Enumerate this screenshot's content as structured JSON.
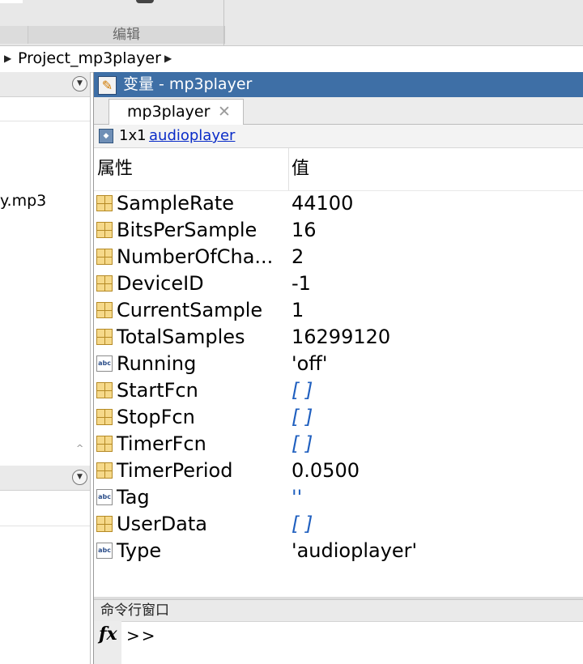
{
  "toolstrip": {
    "section_caption": "编辑"
  },
  "address_bar": {
    "crumb": "Project_mp3player"
  },
  "current_folder": {
    "file_partial": "y.mp3"
  },
  "variables_window": {
    "title": "变量 - mp3player",
    "tab_label": "mp3player",
    "tab_close": "✕",
    "summary_size": "1x1",
    "summary_class_link": "audioplayer",
    "header_property": "属性",
    "header_value": "值",
    "rows": [
      {
        "name": "SampleRate",
        "value": "44100",
        "icon": "grid-icon"
      },
      {
        "name": "BitsPerSample",
        "value": "16",
        "icon": "grid-icon"
      },
      {
        "name": "NumberOfCha...",
        "value": "2",
        "icon": "grid-icon"
      },
      {
        "name": "DeviceID",
        "value": "-1",
        "icon": "grid-icon"
      },
      {
        "name": "CurrentSample",
        "value": "1",
        "icon": "grid-icon"
      },
      {
        "name": "TotalSamples",
        "value": "16299120",
        "icon": "grid-icon"
      },
      {
        "name": "Running",
        "value": "'off'",
        "icon": "abc-icon"
      },
      {
        "name": "StartFcn",
        "value": "[ ]",
        "icon": "grid-icon"
      },
      {
        "name": "StopFcn",
        "value": "[ ]",
        "icon": "grid-icon"
      },
      {
        "name": "TimerFcn",
        "value": "[ ]",
        "icon": "grid-icon"
      },
      {
        "name": "TimerPeriod",
        "value": "0.0500",
        "icon": "grid-icon"
      },
      {
        "name": "Tag",
        "value": "''",
        "icon": "abc-icon"
      },
      {
        "name": "UserData",
        "value": "[ ]",
        "icon": "grid-icon"
      },
      {
        "name": "Type",
        "value": "'audioplayer'",
        "icon": "abc-icon"
      }
    ]
  },
  "command_window": {
    "title": "命令行窗口",
    "fx_label": "fx",
    "prompt": ">>"
  }
}
